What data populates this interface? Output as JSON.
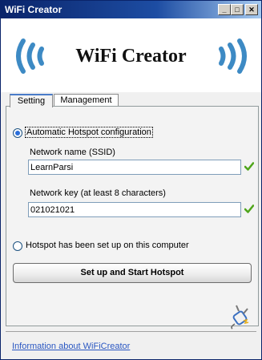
{
  "window": {
    "title": "WiFi Creator",
    "min_glyph": "_",
    "max_glyph": "□",
    "close_glyph": "✕"
  },
  "header": {
    "app_title": "WiFi Creator",
    "left_icon": "wifi-waves-left-icon",
    "right_icon": "wifi-waves-right-icon",
    "accent_color": "#3d8ac4"
  },
  "tabs": [
    {
      "label": "Setting",
      "selected": true
    },
    {
      "label": "Management",
      "selected": false
    }
  ],
  "setting": {
    "auto_option": {
      "label": "Automatic Hotspot configuration",
      "selected": true
    },
    "ssid": {
      "label": "Network name (SSID)",
      "value": "LearnParsi",
      "valid": true
    },
    "key": {
      "label": "Network key (at least 8 characters)",
      "value": "021021021",
      "valid": true
    },
    "existing_option": {
      "label": "Hotspot has been set up on this computer",
      "selected": false
    },
    "start_button": "Set up and Start Hotspot"
  },
  "footer": {
    "plug_icon": "power-plug-icon",
    "link": "Information about WiFiCreator"
  }
}
